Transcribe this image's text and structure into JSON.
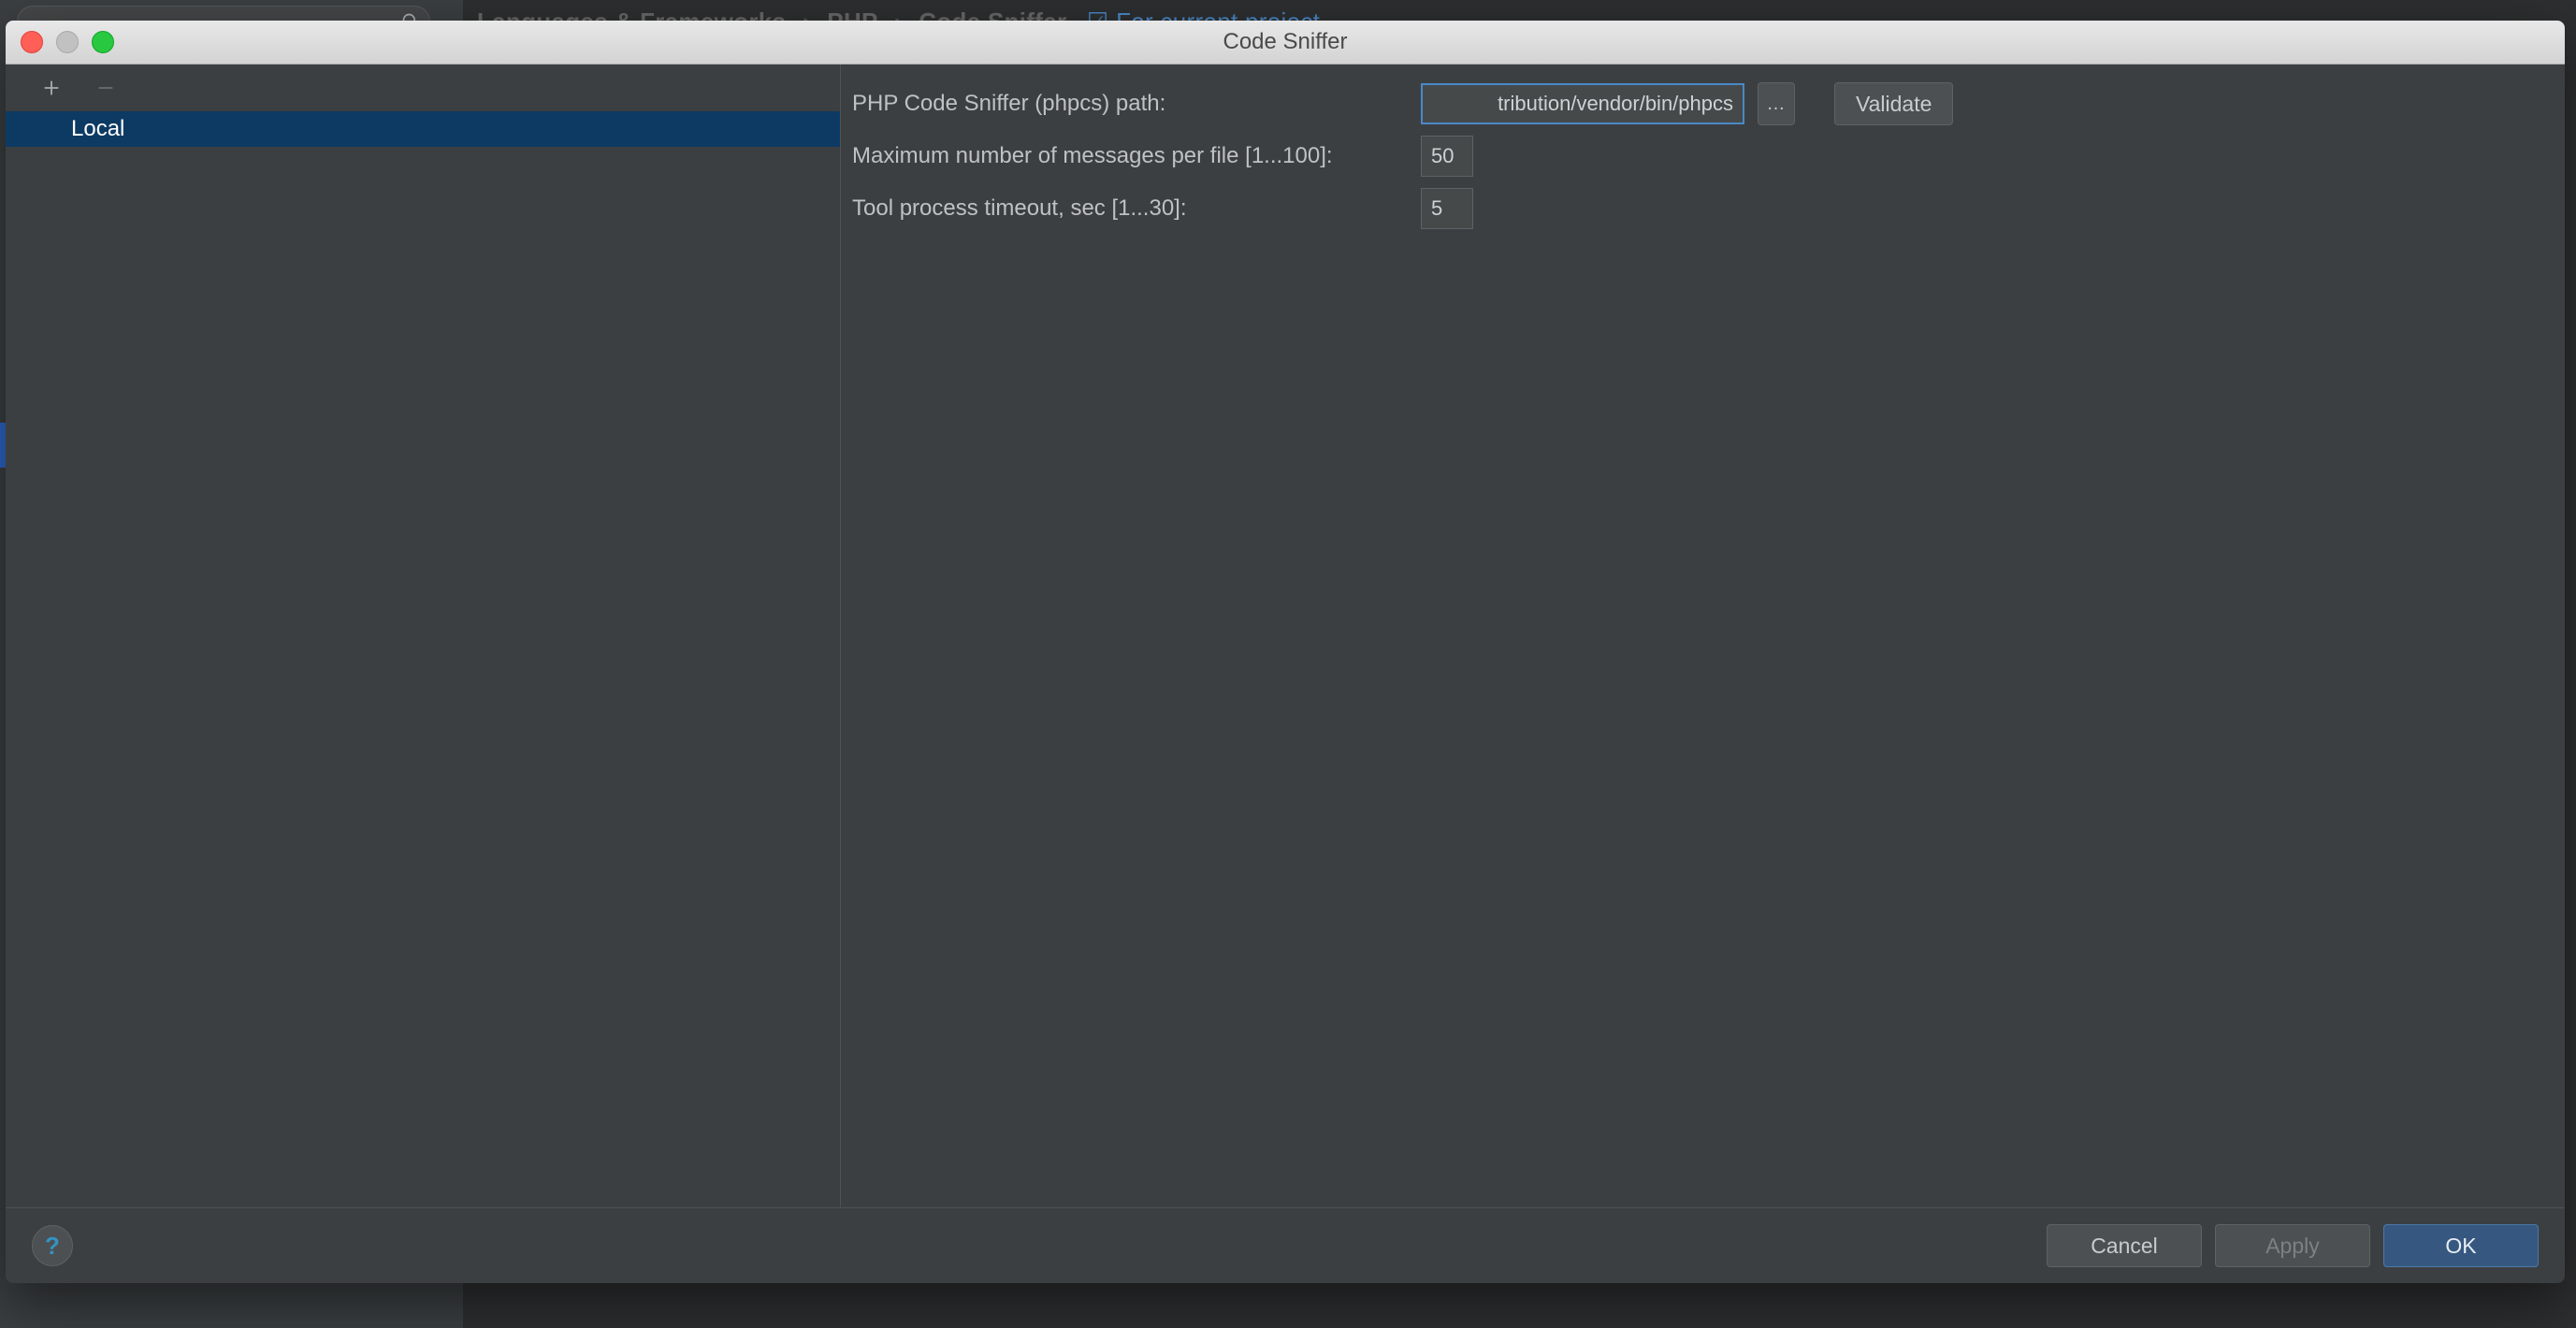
{
  "background": {
    "breadcrumb": {
      "a": "Languages & Frameworks",
      "b": "PHP",
      "c": "Code Sniffer",
      "scope": "For current project"
    }
  },
  "dialog": {
    "title": "Code Sniffer",
    "leftPanel": {
      "items": [
        "Local"
      ]
    },
    "form": {
      "pathLabel": "PHP Code Sniffer (phpcs) path:",
      "pathValue": "tribution/vendor/bin/phpcs",
      "browse": "…",
      "validate": "Validate",
      "maxMsgLabel": "Maximum number of messages per file [1...100]:",
      "maxMsgValue": "50",
      "timeoutLabel": "Tool process timeout, sec [1...30]:",
      "timeoutValue": "5"
    },
    "footer": {
      "help": "?",
      "cancel": "Cancel",
      "apply": "Apply",
      "ok": "OK"
    }
  }
}
